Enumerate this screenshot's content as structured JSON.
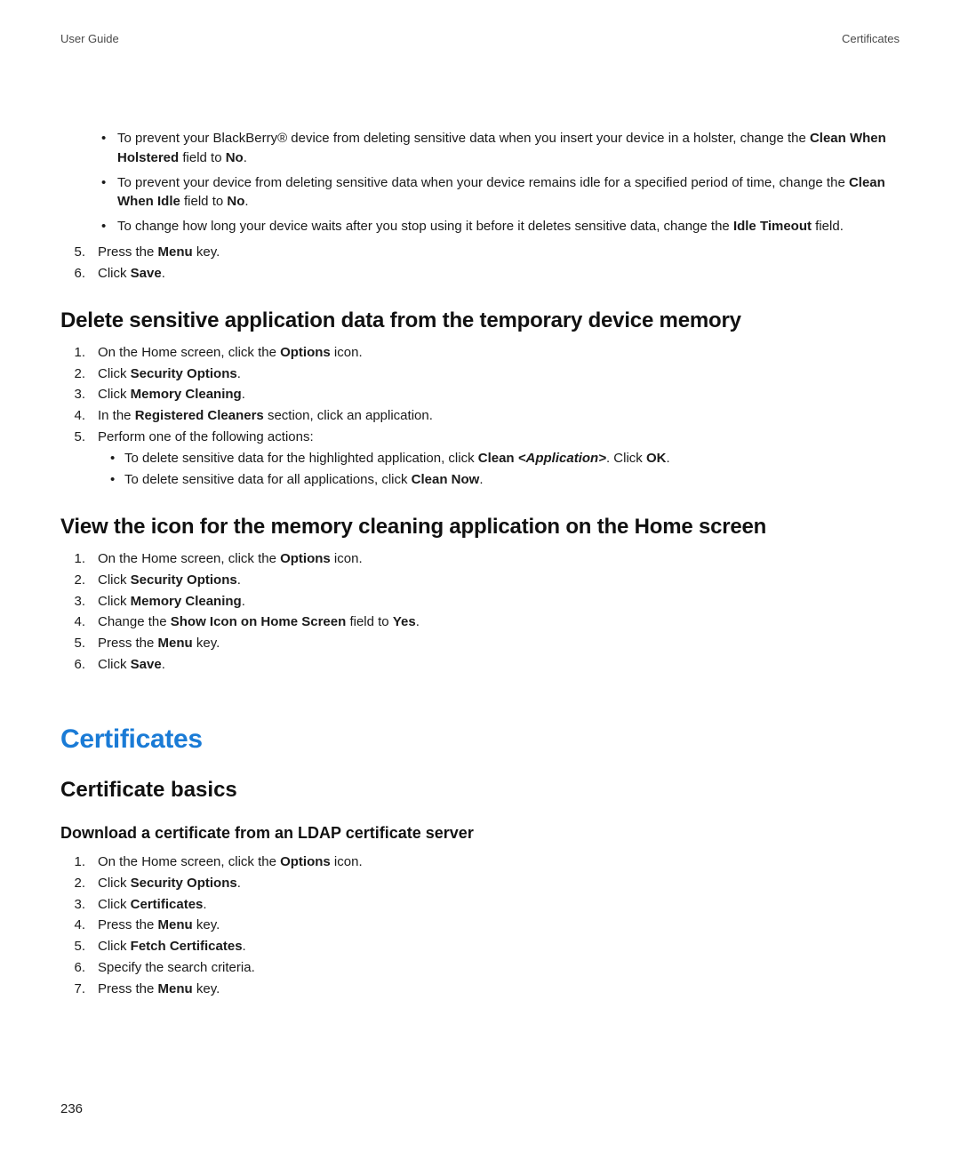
{
  "header": {
    "left": "User Guide",
    "right": "Certificates"
  },
  "intro": {
    "bullets": [
      {
        "segments": [
          {
            "t": "To prevent your BlackBerry® device from deleting sensitive data when you insert your device in a holster, change the "
          },
          {
            "t": "Clean When Holstered",
            "b": true
          },
          {
            "t": " field to "
          },
          {
            "t": "No",
            "b": true
          },
          {
            "t": "."
          }
        ]
      },
      {
        "segments": [
          {
            "t": "To prevent your device from deleting sensitive data when your device remains idle for a specified period of time, change the "
          },
          {
            "t": "Clean When Idle",
            "b": true
          },
          {
            "t": " field to "
          },
          {
            "t": "No",
            "b": true
          },
          {
            "t": "."
          }
        ]
      },
      {
        "segments": [
          {
            "t": "To change how long your device waits after you stop using it before it deletes sensitive data, change the "
          },
          {
            "t": "Idle Timeout",
            "b": true
          },
          {
            "t": " field."
          }
        ]
      }
    ],
    "steps_after": [
      {
        "n": "5.",
        "segments": [
          {
            "t": "Press the "
          },
          {
            "t": "Menu",
            "b": true
          },
          {
            "t": " key."
          }
        ]
      },
      {
        "n": "6.",
        "segments": [
          {
            "t": "Click "
          },
          {
            "t": "Save",
            "b": true
          },
          {
            "t": "."
          }
        ]
      }
    ]
  },
  "sec1": {
    "title": "Delete sensitive application data from the temporary device memory",
    "steps": [
      {
        "n": "1.",
        "segments": [
          {
            "t": "On the Home screen, click the "
          },
          {
            "t": "Options",
            "b": true
          },
          {
            "t": " icon."
          }
        ]
      },
      {
        "n": "2.",
        "segments": [
          {
            "t": "Click "
          },
          {
            "t": "Security Options",
            "b": true
          },
          {
            "t": "."
          }
        ]
      },
      {
        "n": "3.",
        "segments": [
          {
            "t": "Click "
          },
          {
            "t": "Memory Cleaning",
            "b": true
          },
          {
            "t": "."
          }
        ]
      },
      {
        "n": "4.",
        "segments": [
          {
            "t": "In the "
          },
          {
            "t": "Registered Cleaners",
            "b": true
          },
          {
            "t": " section, click an application."
          }
        ]
      },
      {
        "n": "5.",
        "segments": [
          {
            "t": "Perform one of the following actions:"
          }
        ],
        "sub": [
          {
            "segments": [
              {
                "t": "To delete sensitive data for the highlighted application, click "
              },
              {
                "t": "Clean ",
                "b": true
              },
              {
                "t": "<Application>",
                "b": true,
                "i": true
              },
              {
                "t": ". Click "
              },
              {
                "t": "OK",
                "b": true
              },
              {
                "t": "."
              }
            ]
          },
          {
            "segments": [
              {
                "t": "To delete sensitive data for all applications, click "
              },
              {
                "t": "Clean Now",
                "b": true
              },
              {
                "t": "."
              }
            ]
          }
        ]
      }
    ]
  },
  "sec2": {
    "title": "View the icon for the memory cleaning application on the Home screen",
    "steps": [
      {
        "n": "1.",
        "segments": [
          {
            "t": "On the Home screen, click the "
          },
          {
            "t": "Options",
            "b": true
          },
          {
            "t": " icon."
          }
        ]
      },
      {
        "n": "2.",
        "segments": [
          {
            "t": "Click "
          },
          {
            "t": "Security Options",
            "b": true
          },
          {
            "t": "."
          }
        ]
      },
      {
        "n": "3.",
        "segments": [
          {
            "t": "Click "
          },
          {
            "t": "Memory Cleaning",
            "b": true
          },
          {
            "t": "."
          }
        ]
      },
      {
        "n": "4.",
        "segments": [
          {
            "t": "Change the "
          },
          {
            "t": "Show Icon on Home Screen",
            "b": true
          },
          {
            "t": " field to "
          },
          {
            "t": "Yes",
            "b": true
          },
          {
            "t": "."
          }
        ]
      },
      {
        "n": "5.",
        "segments": [
          {
            "t": "Press the "
          },
          {
            "t": "Menu",
            "b": true
          },
          {
            "t": " key."
          }
        ]
      },
      {
        "n": "6.",
        "segments": [
          {
            "t": "Click "
          },
          {
            "t": "Save",
            "b": true
          },
          {
            "t": "."
          }
        ]
      }
    ]
  },
  "chapter": {
    "title": "Certificates",
    "subtitle": "Certificate basics",
    "topic": {
      "title": "Download a certificate from an LDAP certificate server",
      "steps": [
        {
          "n": "1.",
          "segments": [
            {
              "t": "On the Home screen, click the "
            },
            {
              "t": "Options",
              "b": true
            },
            {
              "t": " icon."
            }
          ]
        },
        {
          "n": "2.",
          "segments": [
            {
              "t": "Click "
            },
            {
              "t": "Security Options",
              "b": true
            },
            {
              "t": "."
            }
          ]
        },
        {
          "n": "3.",
          "segments": [
            {
              "t": "Click "
            },
            {
              "t": "Certificates",
              "b": true
            },
            {
              "t": "."
            }
          ]
        },
        {
          "n": "4.",
          "segments": [
            {
              "t": "Press the "
            },
            {
              "t": "Menu",
              "b": true
            },
            {
              "t": " key."
            }
          ]
        },
        {
          "n": "5.",
          "segments": [
            {
              "t": "Click "
            },
            {
              "t": "Fetch Certificates",
              "b": true
            },
            {
              "t": "."
            }
          ]
        },
        {
          "n": "6.",
          "segments": [
            {
              "t": "Specify the search criteria."
            }
          ]
        },
        {
          "n": "7.",
          "segments": [
            {
              "t": "Press the "
            },
            {
              "t": "Menu",
              "b": true
            },
            {
              "t": " key."
            }
          ]
        }
      ]
    }
  },
  "pageNumber": "236"
}
